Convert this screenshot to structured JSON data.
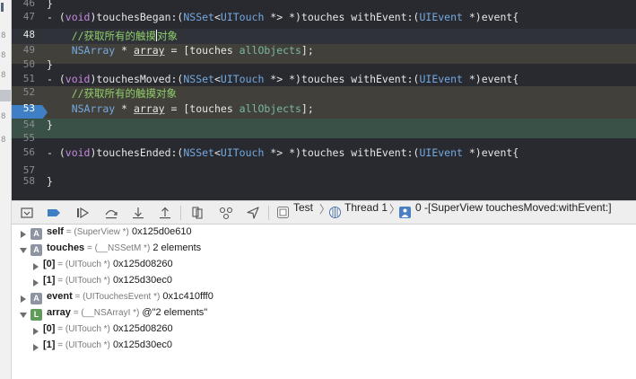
{
  "editor": {
    "lines": [
      {
        "no": "46",
        "tokens": [
          {
            "t": "}",
            "c": "plain"
          }
        ]
      },
      {
        "no": "47",
        "tokens": [
          {
            "t": "- (",
            "c": "plain"
          },
          {
            "t": "void",
            "c": "kw"
          },
          {
            "t": ")touchesBegan:(",
            "c": "plain"
          },
          {
            "t": "NSSet",
            "c": "type"
          },
          {
            "t": "<",
            "c": "plain"
          },
          {
            "t": "UITouch",
            "c": "type"
          },
          {
            "t": " *> *)touches withEvent:(",
            "c": "plain"
          },
          {
            "t": "UIEvent",
            "c": "type"
          },
          {
            "t": " *)event{",
            "c": "plain"
          }
        ]
      },
      {
        "no": "48",
        "tokens": [
          {
            "t": "    ",
            "c": "plain"
          },
          {
            "t": "//获取所有的触摸",
            "c": "comment"
          },
          {
            "t": "",
            "c": "cursor"
          },
          {
            "t": "对象",
            "c": "comment"
          }
        ]
      },
      {
        "no": "49",
        "tokens": [
          {
            "t": "    ",
            "c": "plain"
          },
          {
            "t": "NSArray",
            "c": "type"
          },
          {
            "t": " * ",
            "c": "plain"
          },
          {
            "t": "array",
            "c": "var"
          },
          {
            "t": " = [touches ",
            "c": "plain"
          },
          {
            "t": "allObjects",
            "c": "method"
          },
          {
            "t": "];",
            "c": "plain"
          }
        ]
      },
      {
        "no": "50",
        "tokens": [
          {
            "t": "}",
            "c": "plain"
          }
        ]
      },
      {
        "no": "51",
        "tokens": [
          {
            "t": "- (",
            "c": "plain"
          },
          {
            "t": "void",
            "c": "kw"
          },
          {
            "t": ")touchesMoved:(",
            "c": "plain"
          },
          {
            "t": "NSSet",
            "c": "type"
          },
          {
            "t": "<",
            "c": "plain"
          },
          {
            "t": "UITouch",
            "c": "type"
          },
          {
            "t": " *> *)touches withEvent:(",
            "c": "plain"
          },
          {
            "t": "UIEvent",
            "c": "type"
          },
          {
            "t": " *)event{",
            "c": "plain"
          }
        ]
      },
      {
        "no": "52",
        "tokens": [
          {
            "t": "    ",
            "c": "plain"
          },
          {
            "t": "//获取所有的触摸对象",
            "c": "comment"
          }
        ]
      },
      {
        "no": "53",
        "tokens": [
          {
            "t": "    ",
            "c": "plain"
          },
          {
            "t": "NSArray",
            "c": "type"
          },
          {
            "t": " * ",
            "c": "plain"
          },
          {
            "t": "array",
            "c": "var"
          },
          {
            "t": " = [touches ",
            "c": "plain"
          },
          {
            "t": "allObjects",
            "c": "method"
          },
          {
            "t": "];",
            "c": "plain"
          }
        ]
      },
      {
        "no": "54",
        "tokens": [
          {
            "t": "}",
            "c": "plain"
          }
        ]
      },
      {
        "no": "55",
        "tokens": []
      },
      {
        "no": "56",
        "tokens": [
          {
            "t": "- (",
            "c": "plain"
          },
          {
            "t": "void",
            "c": "kw"
          },
          {
            "t": ")touchesEnded:(",
            "c": "plain"
          },
          {
            "t": "NSSet",
            "c": "type"
          },
          {
            "t": "<",
            "c": "plain"
          },
          {
            "t": "UITouch",
            "c": "type"
          },
          {
            "t": " *> *)touches withEvent:(",
            "c": "plain"
          },
          {
            "t": "UIEvent",
            "c": "type"
          },
          {
            "t": " *)event{",
            "c": "plain"
          }
        ]
      },
      {
        "no": "57",
        "tokens": []
      },
      {
        "no": "58",
        "tokens": [
          {
            "t": "}",
            "c": "plain"
          }
        ]
      }
    ]
  },
  "debug_bar": {
    "scheme": "Test",
    "thread": "Thread 1",
    "frame": "0 -[SuperView touchesMoved:withEvent:]"
  },
  "variables": [
    {
      "level": 0,
      "expanded": false,
      "badge": "A",
      "name": "self",
      "type": "(SuperView *)",
      "value": "0x125d0e610"
    },
    {
      "level": 0,
      "expanded": true,
      "badge": "A",
      "name": "touches",
      "type": "(__NSSetM *)",
      "value": "2 elements"
    },
    {
      "level": 1,
      "expanded": false,
      "badge": "",
      "name": "[0]",
      "type": "(UITouch *)",
      "value": "0x125d08260"
    },
    {
      "level": 1,
      "expanded": false,
      "badge": "",
      "name": "[1]",
      "type": "(UITouch *)",
      "value": "0x125d30ec0"
    },
    {
      "level": 0,
      "expanded": false,
      "badge": "A",
      "name": "event",
      "type": "(UITouchesEvent *)",
      "value": "0x1c410fff0"
    },
    {
      "level": 0,
      "expanded": true,
      "badge": "L",
      "name": "array",
      "type": "(__NSArrayI *)",
      "value": "@\"2 elements\""
    },
    {
      "level": 1,
      "expanded": false,
      "badge": "",
      "name": "[0]",
      "type": "(UITouch *)",
      "value": "0x125d08260"
    },
    {
      "level": 1,
      "expanded": false,
      "badge": "",
      "name": "[1]",
      "type": "(UITouch *)",
      "value": "0x125d30ec0"
    }
  ],
  "colors": {
    "editor_bg": "#292a30",
    "keyword": "#c78ae0",
    "type": "#73a9e0",
    "comment": "#8fcf6a",
    "method": "#79b8a2",
    "breakpoint": "#3f7fc6"
  },
  "icons": [
    "toggle-console-icon",
    "breakpoint-toggle-icon",
    "continue-icon",
    "step-over-icon",
    "step-into-icon",
    "step-out-icon",
    "view-hierarchy-icon",
    "memory-graph-icon",
    "simulate-location-icon",
    "app-icon",
    "thread-icon",
    "frame-icon",
    "disclosure-icon"
  ]
}
